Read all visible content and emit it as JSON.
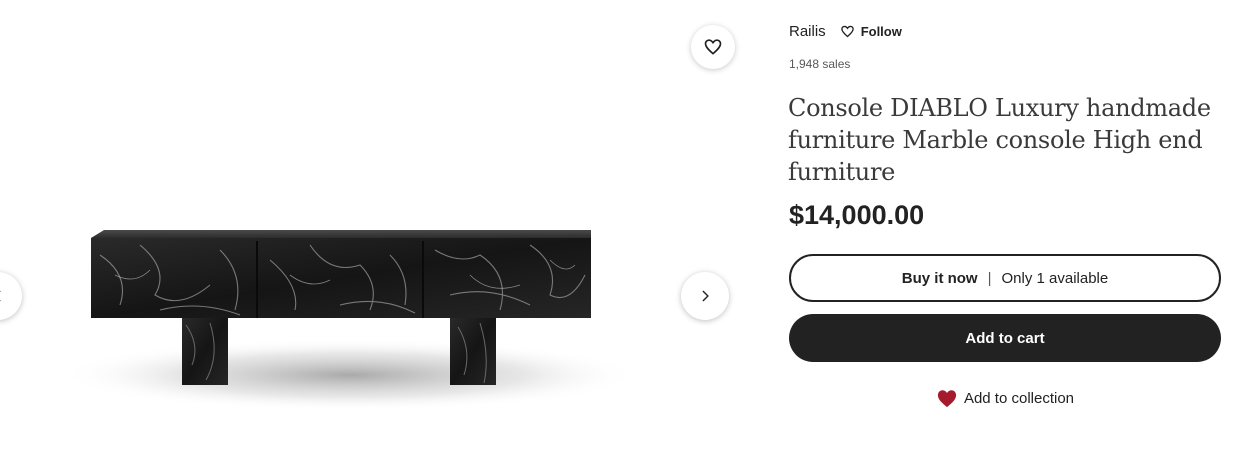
{
  "gallery": {
    "prev_icon": "chevron-left-icon",
    "next_icon": "chevron-right-icon",
    "favorite_icon": "heart-outline-icon",
    "image_alt": "Black marble console on two block legs"
  },
  "shop": {
    "name": "Railis",
    "follow_label": "Follow",
    "sales": "1,948 sales"
  },
  "listing": {
    "title": "Console DIABLO Luxury handmade furniture Marble console High end furniture",
    "price": "$14,000.00"
  },
  "actions": {
    "buy_now_label": "Buy it now",
    "separator": "|",
    "availability": "Only 1 available",
    "add_to_cart_label": "Add to cart",
    "add_to_collection_label": "Add to collection"
  },
  "colors": {
    "primary_button": "#222222",
    "collection_heart": "#a61a2e",
    "text": "#222222"
  }
}
